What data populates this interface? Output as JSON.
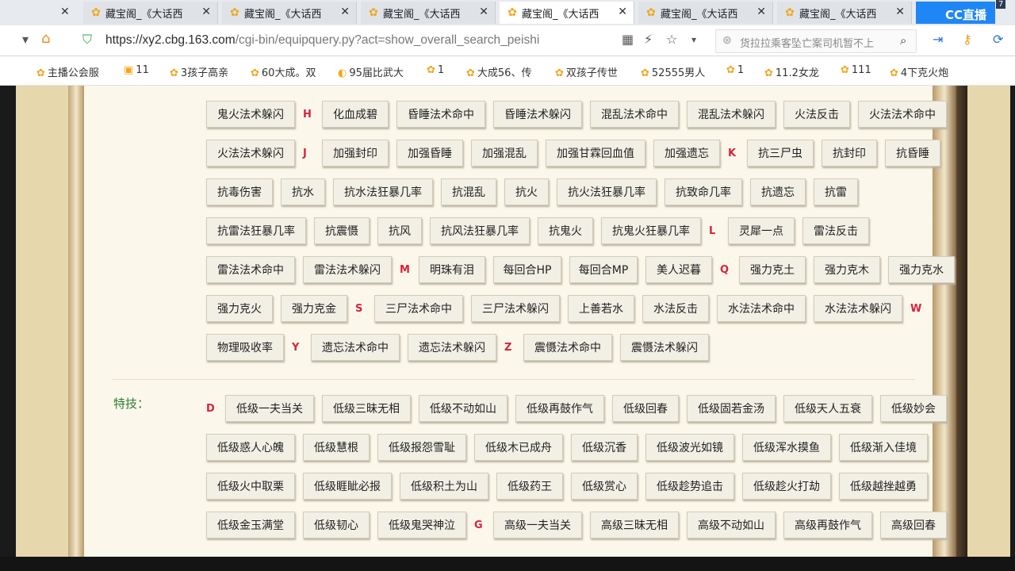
{
  "tabs": [
    {
      "title": "藏宝阁_《大话西"
    },
    {
      "title": "藏宝阁_《大话西"
    },
    {
      "title": "藏宝阁_《大话西"
    },
    {
      "title": "藏宝阁_《大话西"
    },
    {
      "title": "藏宝阁_《大话西"
    },
    {
      "title": "藏宝阁_《大话西"
    }
  ],
  "cc_badge": "CC直播",
  "cc_count": "7",
  "address": {
    "url_main": "https://xy2.cbg.163.com",
    "url_rest": "/cgi-bin/equipquery.py?act=show_overall_search_peishi",
    "search_text": "货拉拉乘客坠亡案司机暂不上"
  },
  "bookmarks": [
    {
      "label": "主播公会服"
    },
    {
      "label": "11"
    },
    {
      "label": "3孩子高亲"
    },
    {
      "label": "60大成。双"
    },
    {
      "label": "95届比武大"
    },
    {
      "label": "1"
    },
    {
      "label": "大成56、传"
    },
    {
      "label": "双孩子传世"
    },
    {
      "label": "52555男人"
    },
    {
      "label": "1"
    },
    {
      "label": "11.2女龙"
    },
    {
      "label": "111"
    },
    {
      "label": "4下克火炮"
    }
  ],
  "attributes": {
    "rows": [
      [
        {
          "t": "鬼火法术躲闪"
        },
        {
          "l": "H"
        },
        {
          "t": "化血成碧"
        },
        {
          "t": "昏睡法术命中"
        },
        {
          "t": "昏睡法术躲闪"
        },
        {
          "t": "混乱法术命中"
        },
        {
          "t": "混乱法术躲闪"
        },
        {
          "t": "火法反击"
        },
        {
          "t": "火法法术命中"
        }
      ],
      [
        {
          "t": "火法法术躲闪"
        },
        {
          "l": "J"
        },
        {
          "t": "加强封印"
        },
        {
          "t": "加强昏睡"
        },
        {
          "t": "加强混乱"
        },
        {
          "t": "加强甘霖回血值"
        },
        {
          "t": "加强遗忘"
        },
        {
          "l": "K"
        },
        {
          "t": "抗三尸虫"
        },
        {
          "t": "抗封印"
        },
        {
          "t": "抗昏睡"
        }
      ],
      [
        {
          "t": "抗毒伤害"
        },
        {
          "t": "抗水"
        },
        {
          "t": "抗水法狂暴几率"
        },
        {
          "t": "抗混乱"
        },
        {
          "t": "抗火"
        },
        {
          "t": "抗火法狂暴几率"
        },
        {
          "t": "抗致命几率"
        },
        {
          "t": "抗遗忘"
        },
        {
          "t": "抗雷"
        }
      ],
      [
        {
          "t": "抗雷法狂暴几率"
        },
        {
          "t": "抗震慑"
        },
        {
          "t": "抗风"
        },
        {
          "t": "抗风法狂暴几率"
        },
        {
          "t": "抗鬼火"
        },
        {
          "t": "抗鬼火狂暴几率"
        },
        {
          "l": "L"
        },
        {
          "t": "灵犀一点"
        },
        {
          "t": "雷法反击"
        }
      ],
      [
        {
          "t": "雷法法术命中"
        },
        {
          "t": "雷法法术躲闪"
        },
        {
          "l": "M"
        },
        {
          "t": "明珠有泪"
        },
        {
          "t": "每回合HP"
        },
        {
          "t": "每回合MP"
        },
        {
          "t": "美人迟暮"
        },
        {
          "l": "Q"
        },
        {
          "t": "强力克土"
        },
        {
          "t": "强力克木"
        },
        {
          "t": "强力克水"
        }
      ],
      [
        {
          "t": "强力克火"
        },
        {
          "t": "强力克金"
        },
        {
          "l": "S"
        },
        {
          "t": "三尸法术命中"
        },
        {
          "t": "三尸法术躲闪"
        },
        {
          "t": "上善若水"
        },
        {
          "t": "水法反击"
        },
        {
          "t": "水法法术命中"
        },
        {
          "t": "水法法术躲闪"
        },
        {
          "l": "W"
        }
      ],
      [
        {
          "t": "物理吸收率"
        },
        {
          "l": "Y"
        },
        {
          "t": "遗忘法术命中"
        },
        {
          "t": "遗忘法术躲闪"
        },
        {
          "l": "Z"
        },
        {
          "t": "震慑法术命中"
        },
        {
          "t": "震慑法术躲闪"
        }
      ]
    ]
  },
  "skills": {
    "label": "特技：",
    "rows": [
      [
        {
          "l": "D"
        },
        {
          "t": "低级一夫当关"
        },
        {
          "t": "低级三昧无相"
        },
        {
          "t": "低级不动如山"
        },
        {
          "t": "低级再鼓作气"
        },
        {
          "t": "低级回春"
        },
        {
          "t": "低级固若金汤"
        },
        {
          "t": "低级天人五衰"
        },
        {
          "t": "低级妙会"
        }
      ],
      [
        {
          "t": "低级惑人心魄"
        },
        {
          "t": "低级慧根"
        },
        {
          "t": "低级报怨雪耻"
        },
        {
          "t": "低级木已成舟"
        },
        {
          "t": "低级沉香"
        },
        {
          "t": "低级波光如镜"
        },
        {
          "t": "低级浑水摸鱼"
        },
        {
          "t": "低级渐入佳境"
        }
      ],
      [
        {
          "t": "低级火中取栗"
        },
        {
          "t": "低级睚眦必报"
        },
        {
          "t": "低级积土为山"
        },
        {
          "t": "低级药王"
        },
        {
          "t": "低级赏心"
        },
        {
          "t": "低级趁势追击"
        },
        {
          "t": "低级趁火打劫"
        },
        {
          "t": "低级越挫越勇"
        }
      ],
      [
        {
          "t": "低级金玉满堂"
        },
        {
          "t": "低级韧心"
        },
        {
          "t": "低级鬼哭神泣"
        },
        {
          "l": "G"
        },
        {
          "t": "高级一夫当关"
        },
        {
          "t": "高级三昧无相"
        },
        {
          "t": "高级不动如山"
        },
        {
          "t": "高级再鼓作气"
        },
        {
          "t": "高级回春"
        }
      ]
    ]
  }
}
